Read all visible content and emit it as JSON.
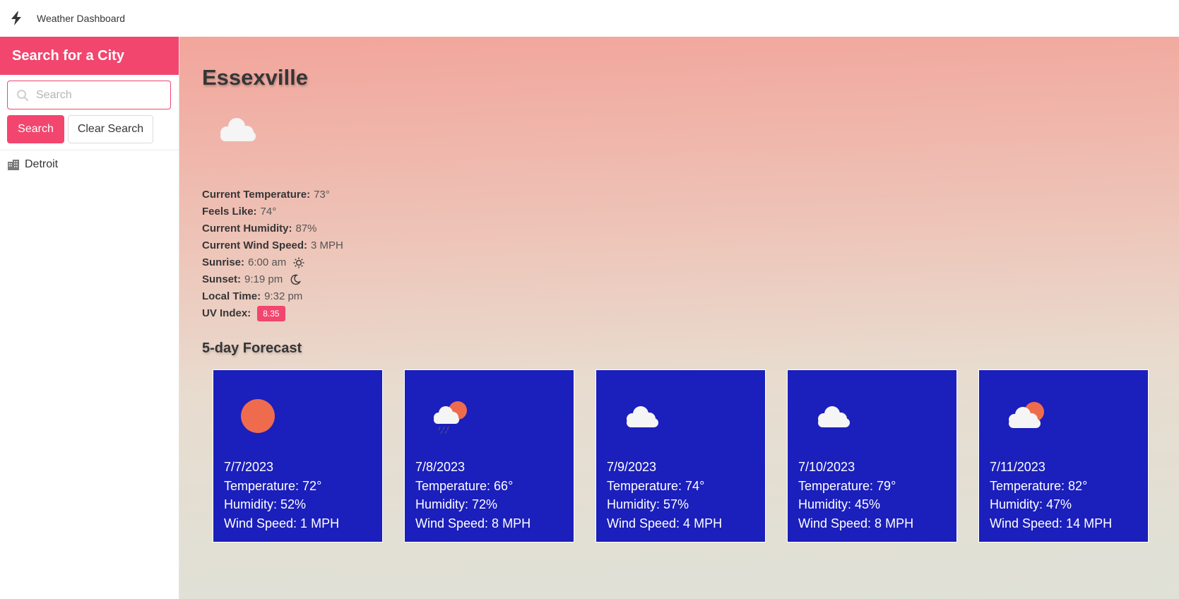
{
  "app": {
    "brand": "Weather Dashboard"
  },
  "sidebar": {
    "heading": "Search for a City",
    "search_placeholder": "Search",
    "search_value": "",
    "search_button": "Search",
    "clear_button": "Clear Search",
    "history": [
      {
        "label": "Detroit",
        "icon": "city-icon"
      }
    ]
  },
  "current": {
    "city": "Essexville",
    "icon": "cloud-icon",
    "temperature_label": "Current Temperature:",
    "temperature": "73°",
    "feels_label": "Feels Like:",
    "feels": "74°",
    "humidity_label": "Current Humidity:",
    "humidity": "87%",
    "wind_label": "Current Wind Speed:",
    "wind": "3 MPH",
    "sunrise_label": "Sunrise:",
    "sunrise": "6:00 am",
    "sunset_label": "Sunset:",
    "sunset": "9:19 pm",
    "localtime_label": "Local Time:",
    "localtime": "9:32 pm",
    "uv_label": "UV Index:",
    "uv": "8.35"
  },
  "forecast": {
    "title": "5-day Forecast",
    "days": [
      {
        "date": "7/7/2023",
        "icon": "sun-icon",
        "temp": "Temperature: 72°",
        "humidity": "Humidity: 52%",
        "wind": "Wind Speed: 1 MPH"
      },
      {
        "date": "7/8/2023",
        "icon": "rain-sun-cloud-icon",
        "temp": "Temperature: 66°",
        "humidity": "Humidity: 72%",
        "wind": "Wind Speed: 8 MPH"
      },
      {
        "date": "7/9/2023",
        "icon": "cloud-icon",
        "temp": "Temperature: 74°",
        "humidity": "Humidity: 57%",
        "wind": "Wind Speed: 4 MPH"
      },
      {
        "date": "7/10/2023",
        "icon": "cloud-icon",
        "temp": "Temperature: 79°",
        "humidity": "Humidity: 45%",
        "wind": "Wind Speed: 8 MPH"
      },
      {
        "date": "7/11/2023",
        "icon": "partly-cloudy-icon",
        "temp": "Temperature: 82°",
        "humidity": "Humidity: 47%",
        "wind": "Wind Speed: 14 MPH"
      }
    ]
  },
  "colors": {
    "accent": "#f2466e",
    "card": "#1b1fbb",
    "sun": "#ee6c4d"
  }
}
